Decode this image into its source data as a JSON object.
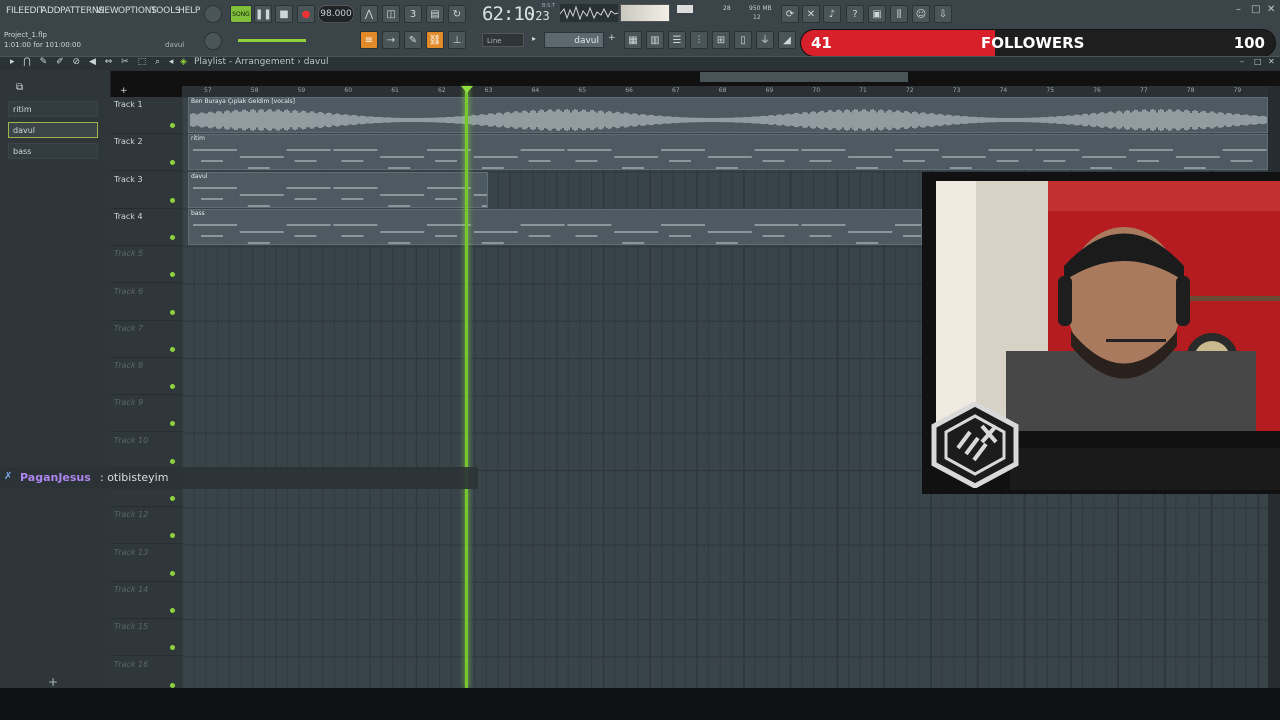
{
  "menu": [
    "FILE",
    "EDIT",
    "ADD",
    "PATTERNS",
    "VIEW",
    "OPTIONS",
    "TOOLS",
    "HELP"
  ],
  "transport": {
    "song_label": "SONG",
    "tempo": "98.000",
    "time": "62:10",
    "time_sub": ":23",
    "time_meta": "B:S:T"
  },
  "cpu": {
    "ram": "950 MB",
    "poly": "12",
    "cpu": "28"
  },
  "project": {
    "title": "Project_1.flp",
    "sub": "1:01:00 for 101:00:00",
    "right": "davul"
  },
  "snap": "Line",
  "pattern_selector": "davul",
  "followers": {
    "current": "41",
    "label": "FOLLOWERS",
    "goal": "100",
    "progress": 0.41
  },
  "playlist": {
    "title": "Playlist - Arrangement",
    "breadcrumb": "davul"
  },
  "patterns": [
    {
      "label": "ritim",
      "selected": false
    },
    {
      "label": "davul",
      "selected": true
    },
    {
      "label": "bass",
      "selected": false
    }
  ],
  "tracks": [
    "Track 1",
    "Track 2",
    "Track 3",
    "Track 4",
    "Track 5",
    "Track 6",
    "Track 7",
    "Track 8",
    "Track 9",
    "Track 10",
    "Track 11",
    "Track 12",
    "Track 13",
    "Track 14",
    "Track 15",
    "Track 16"
  ],
  "clips": [
    {
      "label": "Ben Buraya Çıplak Geldim [vocals]",
      "type": "audio"
    },
    {
      "label": "ritim",
      "type": "pattern"
    },
    {
      "label": "davul",
      "type": "pattern"
    },
    {
      "label": "bass",
      "type": "pattern"
    }
  ],
  "ruler": [
    "57",
    "58",
    "59",
    "60",
    "61",
    "62",
    "63",
    "64",
    "65",
    "66",
    "67",
    "68",
    "69",
    "70",
    "71",
    "72",
    "73",
    "74",
    "75",
    "76",
    "77",
    "78",
    "79"
  ],
  "chat": {
    "user": "PaganJesus",
    "message": ": otibisteyim"
  },
  "colors": {
    "accent": "#8fd13c",
    "follow_red": "#d7202a",
    "orange": "#e08a2a"
  }
}
